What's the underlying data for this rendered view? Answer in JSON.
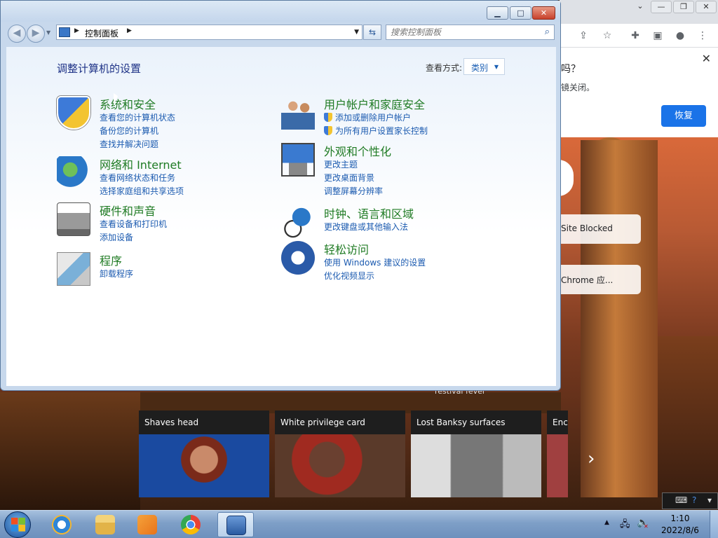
{
  "chrome": {
    "restore_question": "吗？",
    "restore_detail": "镜关闭。",
    "restore_button": "恢复",
    "close_glyph": "✕",
    "snack_blocked": "Site Blocked",
    "snack_chrome": "Chrome 应...",
    "news_strip": "restival fever",
    "news": [
      {
        "title": "Shaves head"
      },
      {
        "title": "White privilege card"
      },
      {
        "title": "Lost Banksy surfaces"
      },
      {
        "title": "Enc"
      }
    ]
  },
  "control_panel": {
    "address_text": "控制面板",
    "search_placeholder": "搜索控制面板",
    "page_title": "调整计算机的设置",
    "view_label": "查看方式:",
    "view_value": "类别",
    "categories": [
      {
        "title": "系统和安全",
        "icon": "shield-icon",
        "links": [
          "查看您的计算机状态",
          "备份您的计算机",
          "查找并解决问题"
        ]
      },
      {
        "title": "网络和 Internet",
        "icon": "network-globe-icon",
        "links": [
          "查看网络状态和任务",
          "选择家庭组和共享选项"
        ]
      },
      {
        "title": "硬件和声音",
        "icon": "printer-icon",
        "links": [
          "查看设备和打印机",
          "添加设备"
        ]
      },
      {
        "title": "程序",
        "icon": "programs-icon",
        "links": [
          "卸载程序"
        ]
      },
      {
        "title": "用户帐户和家庭安全",
        "icon": "users-icon",
        "links": [
          "添加或删除用户帐户",
          "为所有用户设置家长控制"
        ]
      },
      {
        "title": "外观和个性化",
        "icon": "display-icon",
        "links": [
          "更改主题",
          "更改桌面背景",
          "调整屏幕分辨率"
        ]
      },
      {
        "title": "时钟、语言和区域",
        "icon": "clock-globe-icon",
        "links": [
          "更改键盘或其他输入法"
        ]
      },
      {
        "title": "轻松访问",
        "icon": "ease-of-access-icon",
        "links": [
          "使用 Windows 建议的设置",
          "优化视频显示"
        ]
      }
    ]
  },
  "taskbar": {
    "time": "1:10",
    "date": "2022/8/6"
  },
  "colors": {
    "category_title": "#1f7b23",
    "link": "#1c5bb0",
    "page_title": "#1e3287",
    "chrome_blue": "#1a73e8"
  }
}
